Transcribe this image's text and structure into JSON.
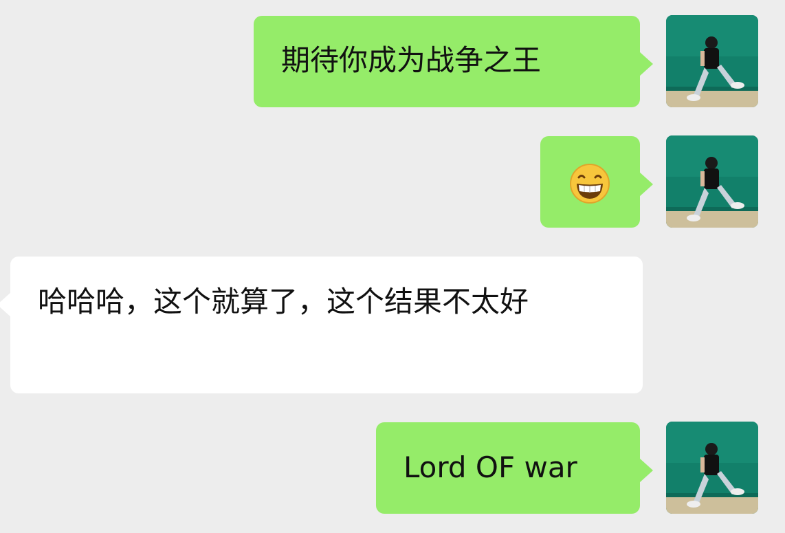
{
  "messages": [
    {
      "side": "out",
      "text": "期待你成为战争之王"
    },
    {
      "side": "out",
      "emoji": "grinning-face-with-smiling-eyes"
    },
    {
      "side": "in",
      "text": "哈哈哈，这个就算了，这个结果不太好"
    },
    {
      "side": "out",
      "text": "Lord OF war"
    }
  ],
  "colors": {
    "background": "#ededed",
    "outgoing_bubble": "#95ec69",
    "incoming_bubble": "#ffffff",
    "avatar_wall": "#12806a",
    "avatar_floor": "#cdbf9b"
  }
}
